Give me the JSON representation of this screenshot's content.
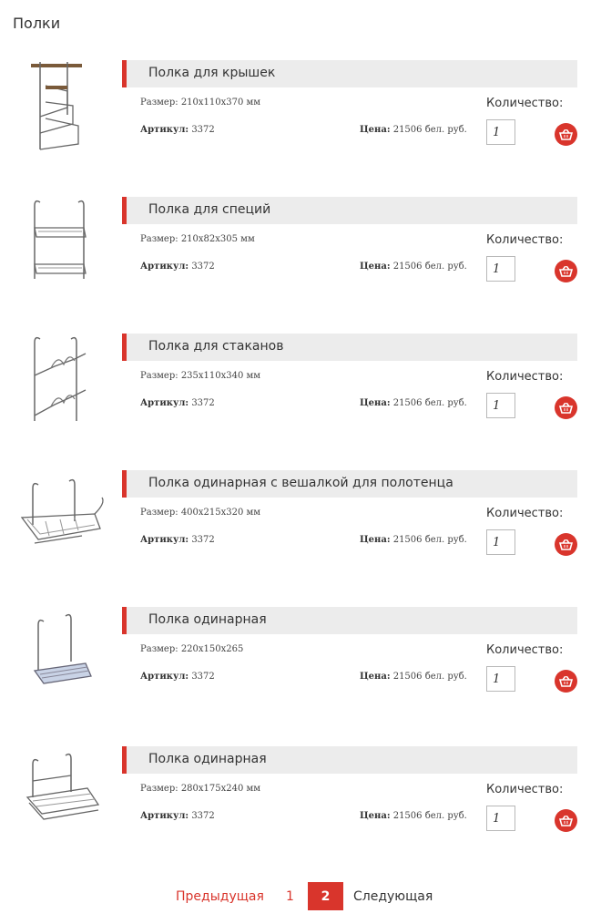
{
  "page": {
    "title": "Полки"
  },
  "labels": {
    "size_prefix": "Размер:",
    "sku_prefix": "Артикул:",
    "price_prefix": "Цена:",
    "quantity": "Количество:"
  },
  "products": [
    {
      "name": "Полка для крышек",
      "size": "210x110x370 мм",
      "sku": "3372",
      "price": "21506 бел. руб.",
      "qty": "1",
      "image_icon": "lid-rack-icon"
    },
    {
      "name": "Полка для специй",
      "size": "210x82x305 мм",
      "sku": "3372",
      "price": "21506 бел. руб.",
      "qty": "1",
      "image_icon": "spice-rack-icon"
    },
    {
      "name": "Полка для стаканов",
      "size": "235x110x340 мм",
      "sku": "3372",
      "price": "21506 бел. руб.",
      "qty": "1",
      "image_icon": "glass-rack-icon"
    },
    {
      "name": "Полка одинарная с вешалкой для полотенца",
      "size": "400x215x320 мм",
      "sku": "3372",
      "price": "21506 бел. руб.",
      "qty": "1",
      "image_icon": "towel-shelf-icon"
    },
    {
      "name": "Полка одинарная",
      "size": "220x150x265",
      "sku": "3372",
      "price": "21506 бел. руб.",
      "qty": "1",
      "image_icon": "single-shelf-icon"
    },
    {
      "name": "Полка одинарная",
      "size": "280x175x240 мм",
      "sku": "3372",
      "price": "21506 бел. руб.",
      "qty": "1",
      "image_icon": "single-shelf-wide-icon"
    }
  ],
  "pagination": {
    "prev": "Предыдущая",
    "page1": "1",
    "page2": "2",
    "next": "Следующая"
  },
  "colors": {
    "accent": "#d9352c",
    "title_bar": "#ececec"
  }
}
